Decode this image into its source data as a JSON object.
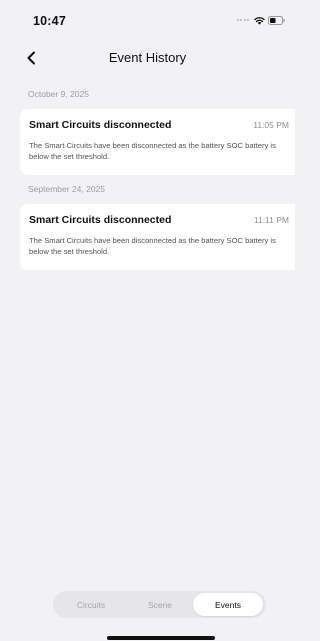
{
  "status_bar": {
    "time": "10:47"
  },
  "nav": {
    "title": "Event History"
  },
  "event_groups": [
    {
      "date": "October 9, 2025",
      "events": [
        {
          "title": "Smart Circuits disconnected",
          "time": "11:05 PM",
          "description": "The Smart Circuits have been disconnected as the battery SOC battery is below the set threshold."
        }
      ]
    },
    {
      "date": "September 24, 2025",
      "events": [
        {
          "title": "Smart Circuits disconnected",
          "time": "11:11 PM",
          "description": "The Smart Circuits have been disconnected as the battery SOC battery is below the set threshold."
        }
      ]
    }
  ],
  "tabs": [
    {
      "label": "Circuits",
      "active": false
    },
    {
      "label": "Scene",
      "active": false
    },
    {
      "label": "Events",
      "active": true
    }
  ]
}
